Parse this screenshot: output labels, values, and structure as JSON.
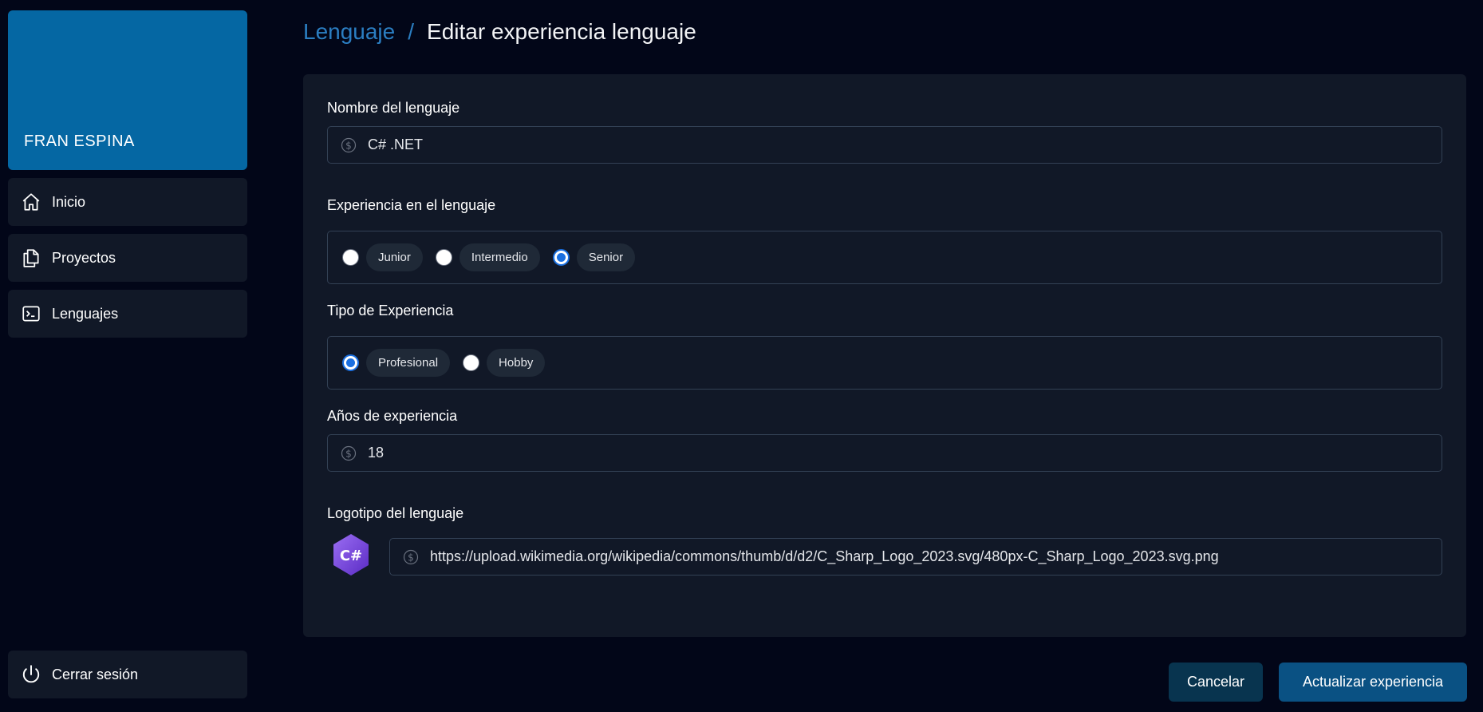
{
  "sidebar": {
    "profile_name": "FRAN ESPINA",
    "items": [
      {
        "label": "Inicio",
        "icon": "home-icon"
      },
      {
        "label": "Proyectos",
        "icon": "documents-icon"
      },
      {
        "label": "Lenguajes",
        "icon": "terminal-icon"
      }
    ],
    "logout": {
      "label": "Cerrar sesión",
      "icon": "power-icon"
    }
  },
  "breadcrumb": {
    "parent": "Lenguaje",
    "separator": "/",
    "current": "Editar experiencia lenguaje"
  },
  "form": {
    "name": {
      "label": "Nombre del lenguaje",
      "value": "C# .NET",
      "icon": "dollar-icon"
    },
    "experience": {
      "label": "Experiencia en el lenguaje",
      "options": [
        "Junior",
        "Intermedio",
        "Senior"
      ],
      "selected": "Senior"
    },
    "type": {
      "label": "Tipo de Experiencia",
      "options": [
        "Profesional",
        "Hobby"
      ],
      "selected": "Profesional"
    },
    "years": {
      "label": "Años de experiencia",
      "value": "18",
      "icon": "dollar-icon"
    },
    "logo": {
      "label": "Logotipo del lenguaje",
      "badge_text": "C#",
      "url": "https://upload.wikimedia.org/wikipedia/commons/thumb/d/d2/C_Sharp_Logo_2023.svg/480px-C_Sharp_Logo_2023.svg.png",
      "icon": "dollar-icon"
    }
  },
  "actions": {
    "cancel_label": "Cancelar",
    "submit_label": "Actualizar experiencia"
  },
  "colors": {
    "background": "#020618",
    "card": "#111827",
    "accent": "#0567a3",
    "link": "#2b7ec2",
    "radio_checked": "#1a6fe0"
  }
}
